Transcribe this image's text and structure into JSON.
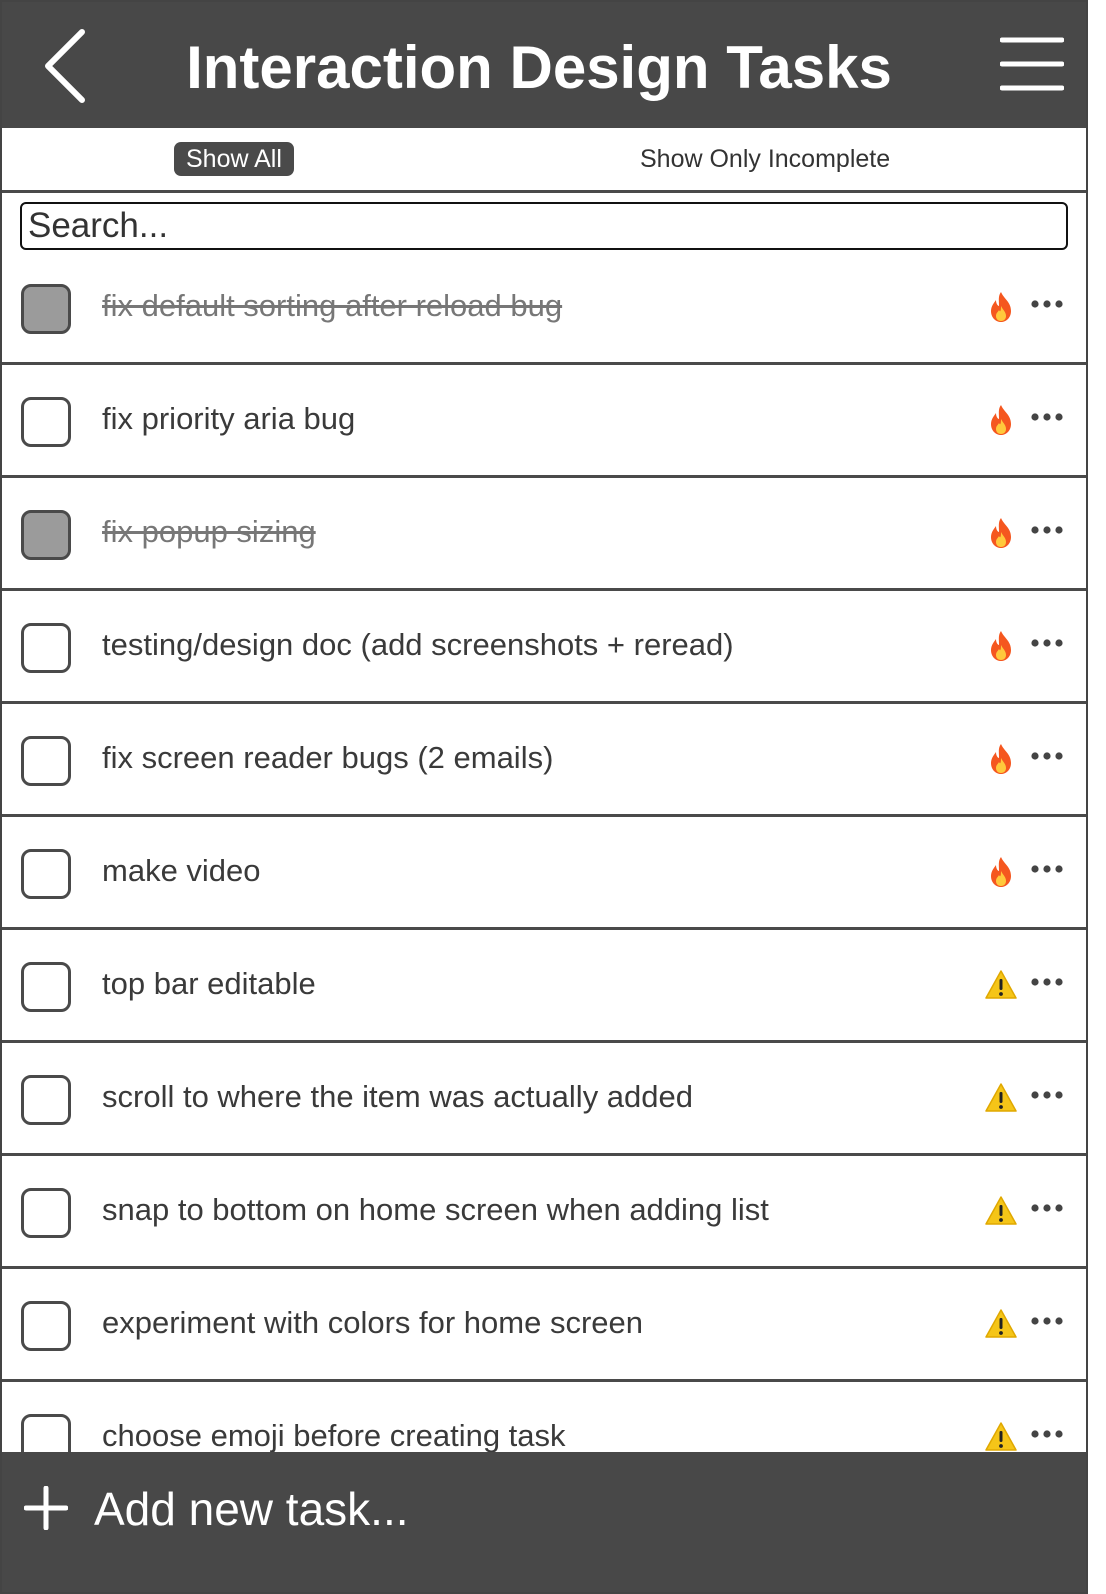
{
  "header": {
    "title": "Interaction Design Tasks",
    "back_icon": "chevron-left-icon",
    "menu_icon": "hamburger-menu-icon"
  },
  "filters": {
    "show_all": "Show All",
    "show_incomplete": "Show Only Incomplete",
    "active": "Show All"
  },
  "search": {
    "placeholder": "Search...",
    "value": ""
  },
  "tasks": [
    {
      "label": "fix default sorting after reload bug",
      "done": true,
      "priority": "fire-icon"
    },
    {
      "label": "fix priority aria bug",
      "done": false,
      "priority": "fire-icon"
    },
    {
      "label": "fix popup sizing",
      "done": true,
      "priority": "fire-icon"
    },
    {
      "label": "testing/design doc (add screenshots + reread)",
      "done": false,
      "priority": "fire-icon"
    },
    {
      "label": "fix screen reader bugs (2 emails)",
      "done": false,
      "priority": "fire-icon"
    },
    {
      "label": "make video",
      "done": false,
      "priority": "fire-icon"
    },
    {
      "label": "top bar editable",
      "done": false,
      "priority": "warning-icon"
    },
    {
      "label": "scroll to where the item was actually added",
      "done": false,
      "priority": "warning-icon"
    },
    {
      "label": "snap to bottom on home screen when adding list",
      "done": false,
      "priority": "warning-icon"
    },
    {
      "label": "experiment with colors for home screen",
      "done": false,
      "priority": "warning-icon"
    },
    {
      "label": "choose emoji before creating task",
      "done": false,
      "priority": "warning-icon"
    }
  ],
  "footer": {
    "add_label": "Add new task...",
    "icon": "plus-icon"
  },
  "colors": {
    "bar": "#484848",
    "checked": "#9b9b9b",
    "fire": "#f5571f",
    "warning": "#f5c518"
  }
}
